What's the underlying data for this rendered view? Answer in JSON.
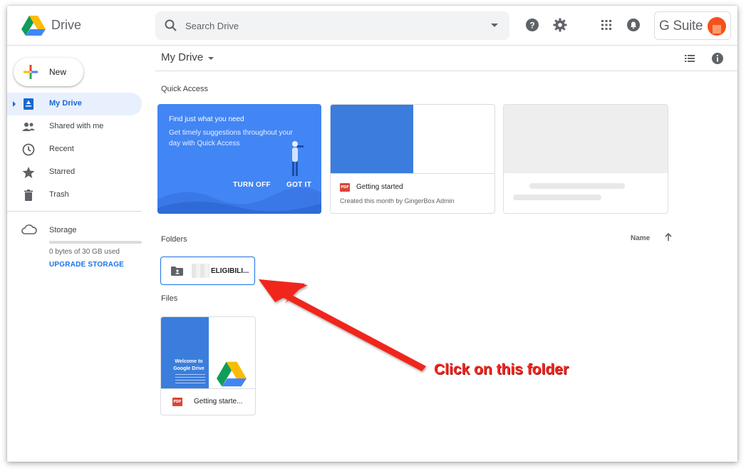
{
  "app": {
    "brand": "Drive"
  },
  "search": {
    "placeholder": "Search Drive"
  },
  "topbar": {
    "icons": [
      "help-icon",
      "settings-icon",
      "apps-icon",
      "notifications-icon"
    ],
    "gsuite_label": "G Suite"
  },
  "sidebar": {
    "new_label": "New",
    "items": [
      {
        "label": "My Drive",
        "icon": "my-drive-icon",
        "active": true
      },
      {
        "label": "Shared with me",
        "icon": "shared-icon"
      },
      {
        "label": "Recent",
        "icon": "clock-icon"
      },
      {
        "label": "Starred",
        "icon": "star-icon"
      },
      {
        "label": "Trash",
        "icon": "trash-icon"
      }
    ],
    "storage": {
      "label": "Storage",
      "used_text": "0 bytes of 30 GB used",
      "used_fraction": 0,
      "upgrade_label": "UPGRADE STORAGE"
    }
  },
  "main": {
    "title": "My Drive",
    "quick_access": {
      "title": "Quick Access",
      "promo": {
        "title": "Find just what you need",
        "body": "Get timely suggestions throughout your day with Quick Access",
        "turn_off": "TURN OFF",
        "got_it": "GOT IT"
      },
      "file": {
        "badge": "PDF",
        "name": "Getting started",
        "meta": "Created this month by GingerBox Admin"
      }
    },
    "folders": {
      "title": "Folders",
      "sort_label": "Name",
      "items": [
        {
          "name": "ELIGIBILI..."
        }
      ]
    },
    "files": {
      "title": "Files",
      "items": [
        {
          "badge": "PDF",
          "name": "Getting starte...",
          "thumb_title": "Welcome to Google Drive"
        }
      ]
    }
  },
  "annotation": {
    "text": "Click on this folder",
    "color": "#f0271f"
  },
  "colors": {
    "accent": "#1a73e8",
    "active_bg": "#e8f0fe",
    "promo_blue": "#4285f4",
    "pdf_red": "#db4437"
  }
}
